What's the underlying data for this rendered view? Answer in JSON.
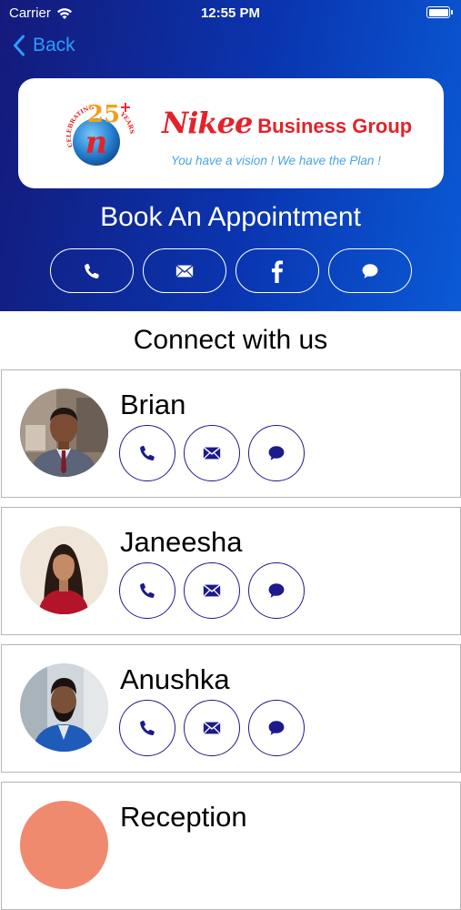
{
  "status_bar": {
    "carrier": "Carrier",
    "time": "12:55 PM"
  },
  "nav": {
    "back_label": "Back"
  },
  "logo": {
    "badge_number": "25",
    "badge_plus": "+",
    "badge_text_left": "CELEBRATING",
    "badge_text_right": "YEARS",
    "badge_letter": "n",
    "brand_script": "Nikee",
    "brand_rest": "Business Group",
    "tagline": "You have a vision ! We have the Plan !"
  },
  "appointment": {
    "title": "Book An Appointment",
    "actions": [
      {
        "name": "phone",
        "icon": "phone-icon"
      },
      {
        "name": "email",
        "icon": "mail-icon"
      },
      {
        "name": "facebook",
        "icon": "facebook-icon"
      },
      {
        "name": "chat",
        "icon": "chat-bubble-icon"
      }
    ]
  },
  "connect": {
    "title": "Connect with us",
    "contacts": [
      {
        "name": "Brian"
      },
      {
        "name": "Janeesha"
      },
      {
        "name": "Anushka"
      },
      {
        "name": "Reception"
      }
    ]
  },
  "colors": {
    "header_gradient_start": "#141a7a",
    "header_gradient_end": "#0a5ad6",
    "back_link": "#2e9bff",
    "brand_red": "#e2232a",
    "tagline_blue": "#4aa3e0",
    "icon_navy": "#1d1a8c",
    "card_border": "#b5b5b5"
  }
}
